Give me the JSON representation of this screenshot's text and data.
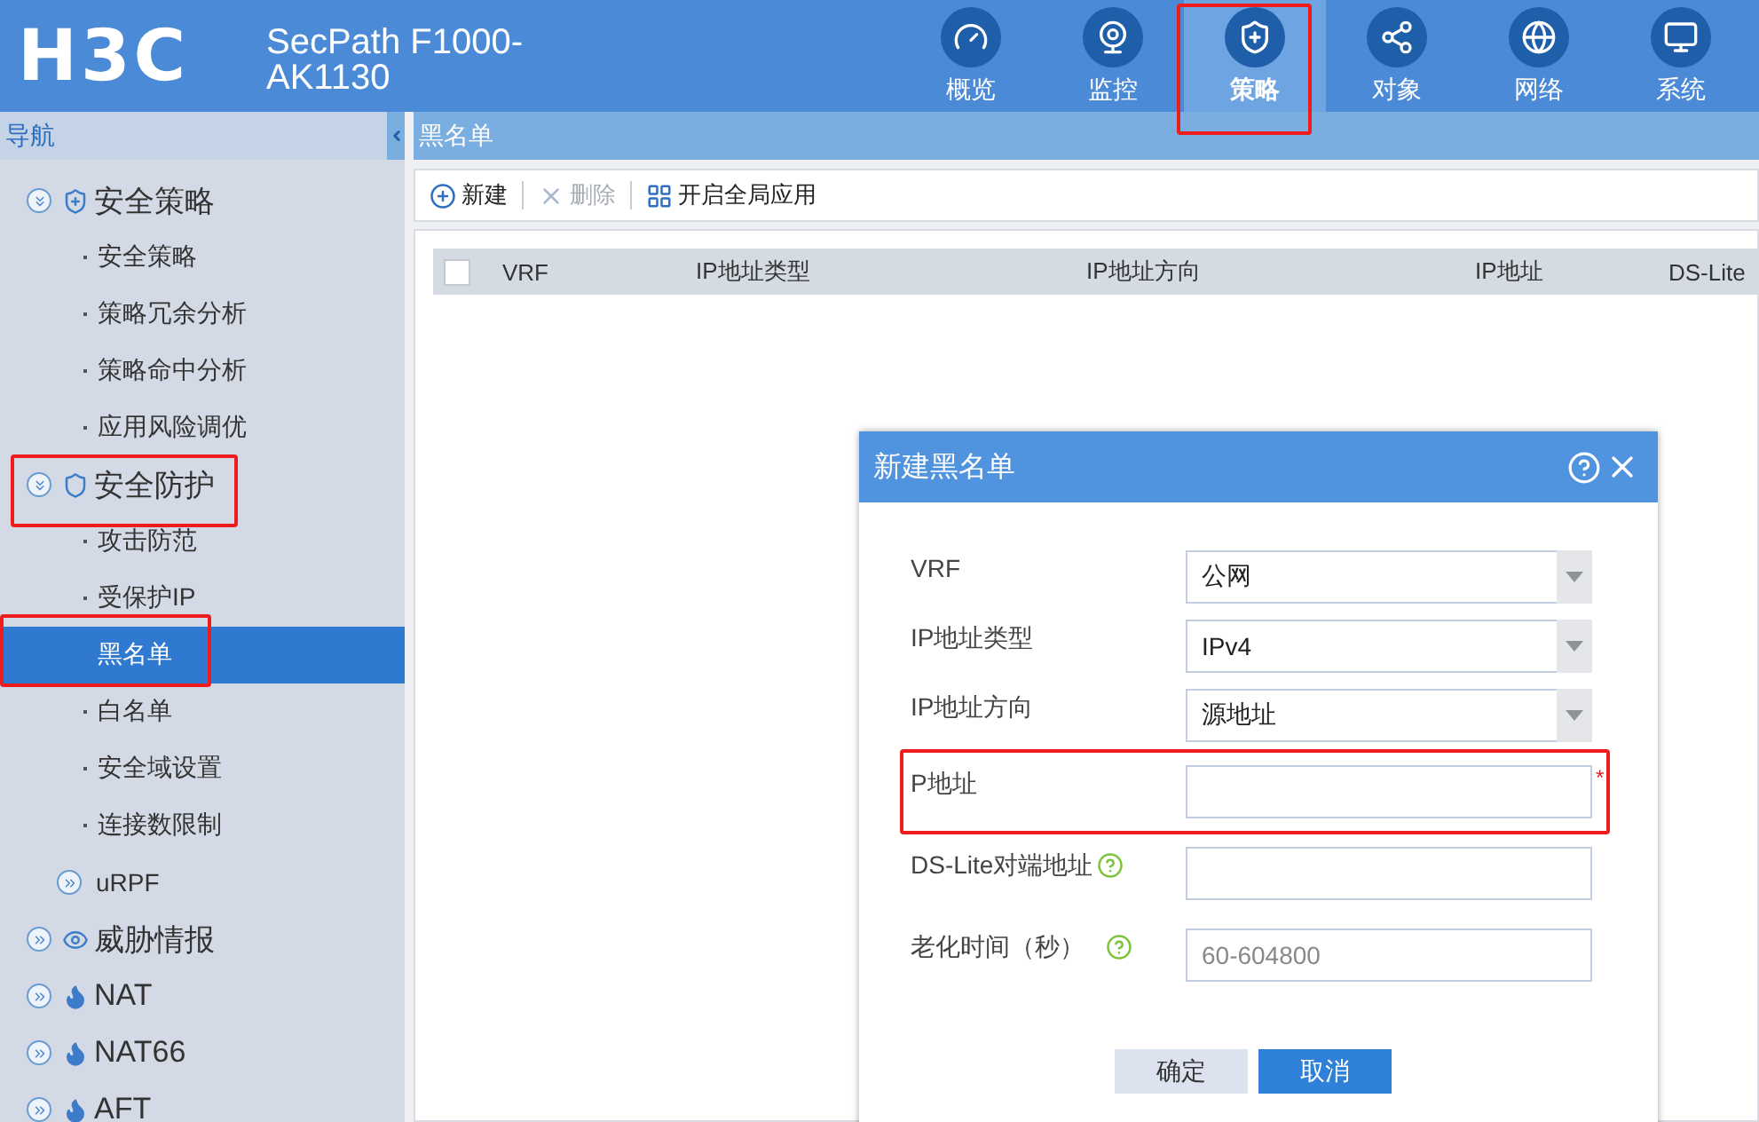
{
  "header": {
    "logo": "H3C",
    "product": "SecPath F1000-AK1130",
    "nav": [
      {
        "label": "概览",
        "selected": false,
        "highlighted": false
      },
      {
        "label": "监控",
        "selected": false,
        "highlighted": false
      },
      {
        "label": "策略",
        "selected": true,
        "highlighted": true
      },
      {
        "label": "对象",
        "selected": false,
        "highlighted": false
      },
      {
        "label": "网络",
        "selected": false,
        "highlighted": false
      },
      {
        "label": "系统",
        "selected": false,
        "highlighted": false
      }
    ]
  },
  "sidebar": {
    "title": "导航",
    "items": [
      {
        "label": "安全策略",
        "expanded": true,
        "highlighted": false,
        "children": [
          {
            "kind": "item",
            "label": "安全策略",
            "selected": false,
            "highlighted": false
          },
          {
            "kind": "item",
            "label": "策略冗余分析",
            "selected": false,
            "highlighted": false
          },
          {
            "kind": "item",
            "label": "策略命中分析",
            "selected": false,
            "highlighted": false
          },
          {
            "kind": "item",
            "label": "应用风险调优",
            "selected": false,
            "highlighted": false
          }
        ]
      },
      {
        "label": "安全防护",
        "expanded": true,
        "highlighted": true,
        "children": [
          {
            "kind": "item",
            "label": "攻击防范",
            "selected": false,
            "highlighted": false
          },
          {
            "kind": "item",
            "label": "受保护IP",
            "selected": false,
            "highlighted": false
          },
          {
            "kind": "item",
            "label": "黑名单",
            "selected": true,
            "highlighted": true
          },
          {
            "kind": "item",
            "label": "白名单",
            "selected": false,
            "highlighted": false
          },
          {
            "kind": "item",
            "label": "安全域设置",
            "selected": false,
            "highlighted": false
          },
          {
            "kind": "item",
            "label": "连接数限制",
            "selected": false,
            "highlighted": false
          },
          {
            "kind": "group",
            "label": "uRPF",
            "expanded": false
          }
        ]
      },
      {
        "label": "威胁情报",
        "expanded": false,
        "highlighted": false
      },
      {
        "label": "NAT",
        "expanded": false,
        "highlighted": false
      },
      {
        "label": "NAT66",
        "expanded": false,
        "highlighted": false
      },
      {
        "label": "AFT",
        "expanded": false,
        "highlighted": false
      }
    ]
  },
  "page": {
    "title": "黑名单",
    "toolbar": [
      {
        "label": "新建",
        "disabled": false
      },
      {
        "label": "删除",
        "disabled": true
      },
      {
        "label": "开启全局应用",
        "disabled": false
      }
    ],
    "table": {
      "checked": false,
      "columns": [
        "VRF",
        "IP地址类型",
        "IP地址方向",
        "IP地址",
        "DS-Lite"
      ]
    }
  },
  "dialog": {
    "title": "新建黑名单",
    "fields": [
      {
        "label": "VRF",
        "kind": "select",
        "value": "公网",
        "help": false,
        "highlighted": false
      },
      {
        "label": "IP地址类型",
        "kind": "select",
        "value": "IPv4",
        "help": false,
        "highlighted": false
      },
      {
        "label": "IP地址方向",
        "kind": "select",
        "value": "源地址",
        "help": false,
        "highlighted": false
      },
      {
        "label": "P地址",
        "kind": "input",
        "required_mark": "*",
        "help": false,
        "highlighted": true
      },
      {
        "label": "DS-Lite对端地址",
        "kind": "input",
        "help": true,
        "highlighted": false
      },
      {
        "label": "老化时间（秒）",
        "kind": "input",
        "placeholder": "60-604800",
        "help": true,
        "highlighted": false
      }
    ],
    "buttons": [
      {
        "label": "确定",
        "primary": false
      },
      {
        "label": "取消",
        "primary": true
      }
    ]
  }
}
